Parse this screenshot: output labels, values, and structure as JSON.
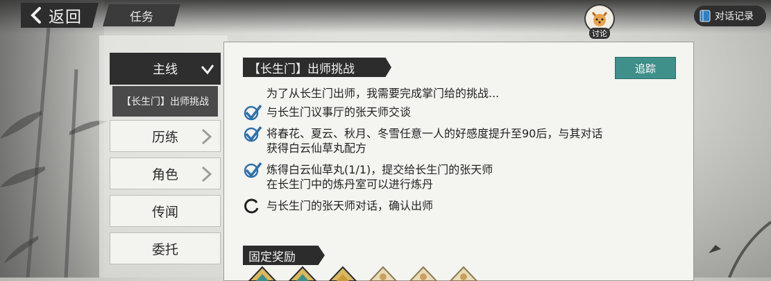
{
  "topbar": {
    "back_label": "返回",
    "title": "任务",
    "discuss_label": "讨论",
    "dialog_log_label": "对话记录"
  },
  "sidebar": {
    "main_label": "主线",
    "sub_quest": "【长生门】出师挑战",
    "items": [
      {
        "label": "历练",
        "has_chevron": true
      },
      {
        "label": "角色",
        "has_chevron": true
      },
      {
        "label": "传闻",
        "has_chevron": false
      },
      {
        "label": "委托",
        "has_chevron": false
      }
    ]
  },
  "quest": {
    "title": "【长生门】出师挑战",
    "track_label": "追踪",
    "description": "为了从长生门出师，我需要完成掌门给的挑战...",
    "tasks": [
      {
        "status": "done",
        "lines": [
          "与长生门议事厅的张天师交谈"
        ]
      },
      {
        "status": "done",
        "lines": [
          "将春花、夏云、秋月、冬雪任意一人的好感度提升至90后，与其对话",
          "获得白云仙草丸配方"
        ]
      },
      {
        "status": "done",
        "lines": [
          "炼得白云仙草丸(1/1)，提交给长生门的张天师",
          "在长生门中的炼丹室可以进行炼丹"
        ]
      },
      {
        "status": "in-progress",
        "lines": [
          "与长生门的张天师对话，确认出师"
        ]
      }
    ]
  },
  "rewards": {
    "title": "固定奖励",
    "items": [
      "reward-scroll-icon",
      "reward-scroll-icon",
      "reward-scroll-icon",
      "reward-pouch-icon",
      "reward-pouch-icon",
      "reward-pouch-icon"
    ]
  },
  "colors": {
    "accent_teal": "#3f8f8a",
    "check_blue": "#2f6fa8",
    "dark_ink": "#2c2c2c"
  }
}
